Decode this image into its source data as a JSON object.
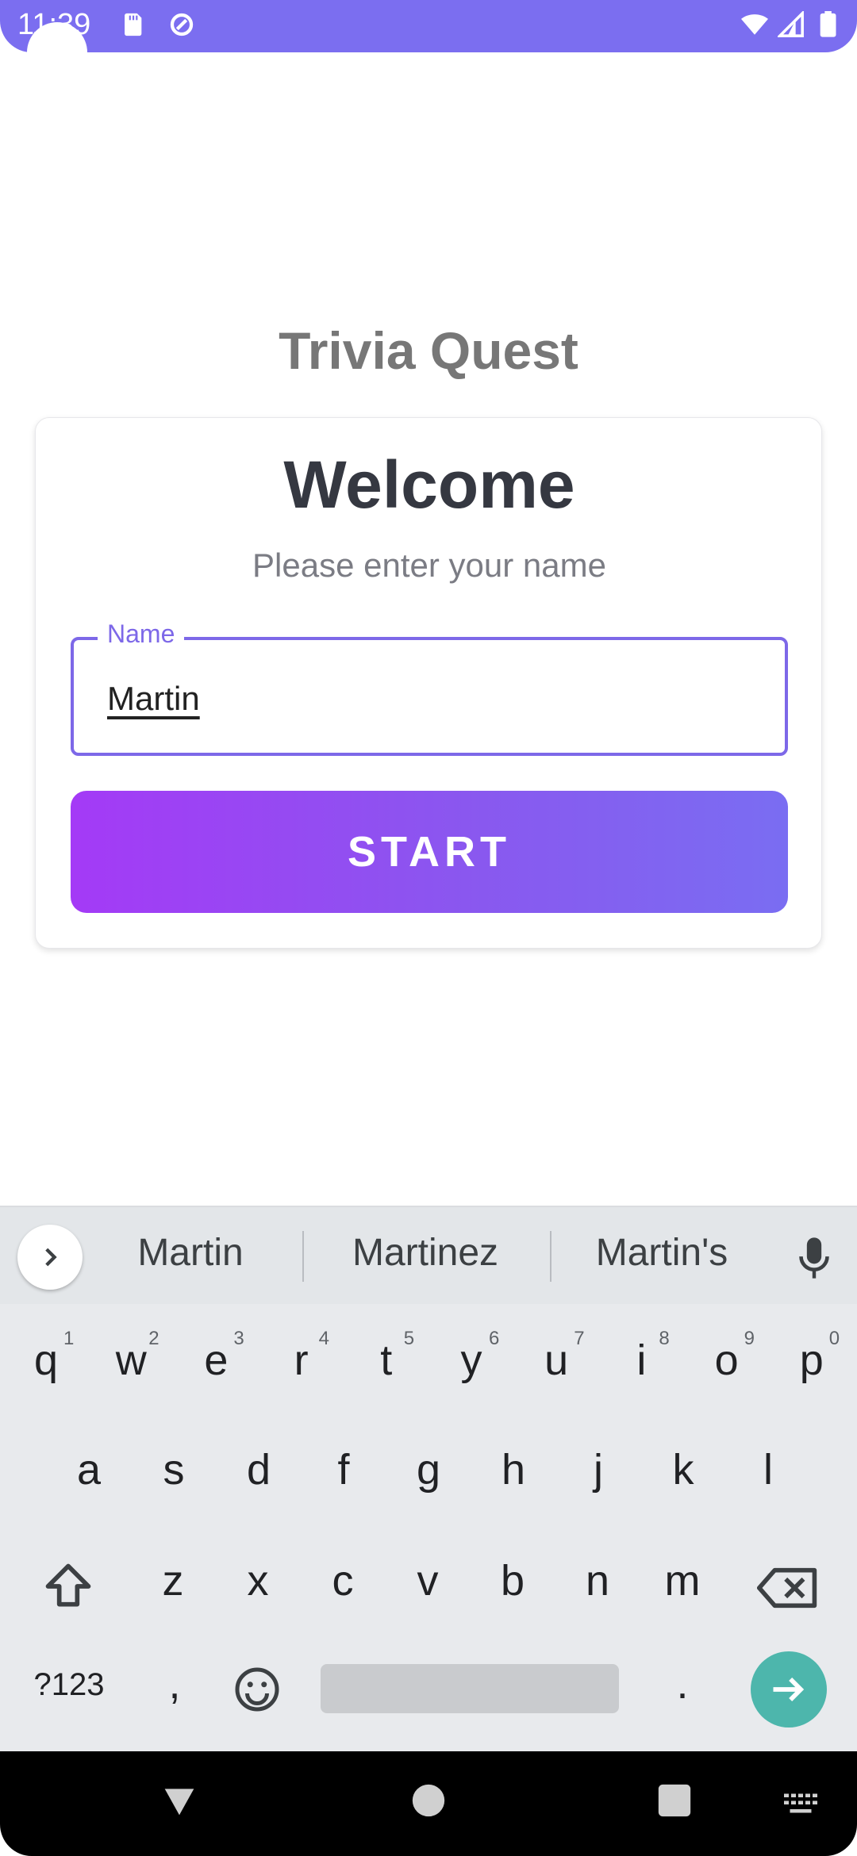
{
  "status_bar": {
    "time": "11:39",
    "icons": [
      "sd-card-icon",
      "data-saver-icon",
      "wifi-icon",
      "signal-icon",
      "battery-icon"
    ],
    "color": "#7b6ef0"
  },
  "app": {
    "title": "Trivia Quest",
    "card": {
      "heading": "Welcome",
      "subtitle": "Please enter your name",
      "name_field": {
        "label": "Name",
        "value": "Martin"
      },
      "start_button": "START"
    }
  },
  "keyboard": {
    "suggestions": [
      "Martin",
      "Martinez",
      "Martin's"
    ],
    "row1": [
      "q",
      "w",
      "e",
      "r",
      "t",
      "y",
      "u",
      "i",
      "o",
      "p"
    ],
    "row1_hints": [
      "1",
      "2",
      "3",
      "4",
      "5",
      "6",
      "7",
      "8",
      "9",
      "0"
    ],
    "row2": [
      "a",
      "s",
      "d",
      "f",
      "g",
      "h",
      "j",
      "k",
      "l"
    ],
    "row3": [
      "z",
      "x",
      "c",
      "v",
      "b",
      "n",
      "m"
    ],
    "bottom": {
      "symbols": "?123",
      "comma": ",",
      "period": "."
    },
    "accent": "#4db6ac"
  }
}
